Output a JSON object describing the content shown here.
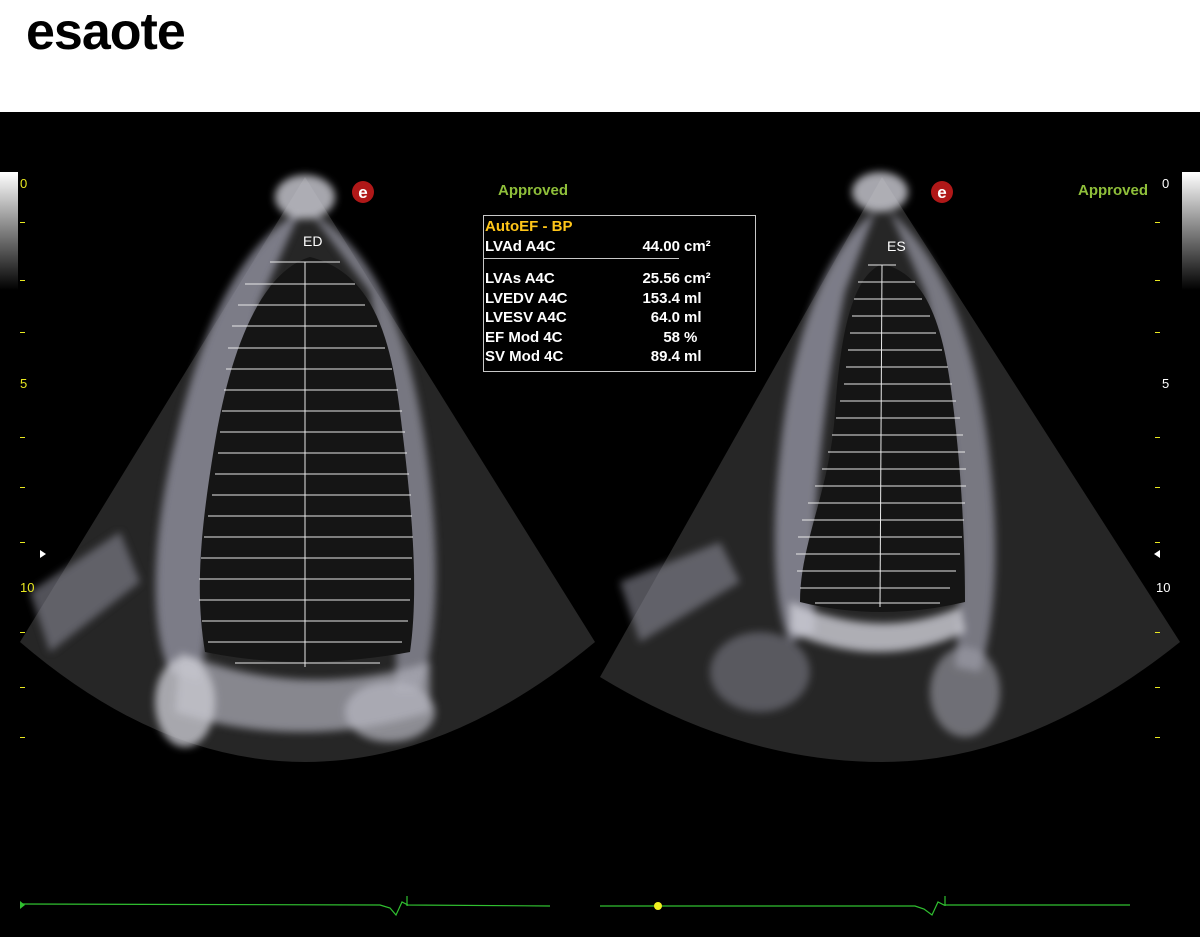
{
  "brand": {
    "logo_text": "esaote"
  },
  "left_view": {
    "label": "ED",
    "status": "Approved",
    "mark": "e"
  },
  "right_view": {
    "label": "ES",
    "status": "Approved",
    "mark": "e"
  },
  "depth_scale": {
    "left": [
      "0",
      "5",
      "10"
    ],
    "right": [
      "0",
      "5",
      "10"
    ]
  },
  "measurements": {
    "title": "AutoEF - BP",
    "rows": [
      {
        "label": "LVAd A4C",
        "value": "44.00",
        "unit": "cm²"
      },
      {
        "label": "LVAs A4C",
        "value": "25.56",
        "unit": "cm²"
      },
      {
        "label": "LVEDV A4C",
        "value": "153.4",
        "unit": "ml"
      },
      {
        "label": "LVESV A4C",
        "value": "64.0",
        "unit": "ml"
      },
      {
        "label": "EF Mod 4C",
        "value": "58",
        "unit": "%"
      },
      {
        "label": "SV Mod 4C",
        "value": "89.4",
        "unit": "ml"
      }
    ]
  },
  "colors": {
    "status": "#8fbf3a",
    "depth_labels": "#e8e820",
    "title": "#ffc619",
    "ecg": "#30c030",
    "contour": "#e0a010"
  }
}
